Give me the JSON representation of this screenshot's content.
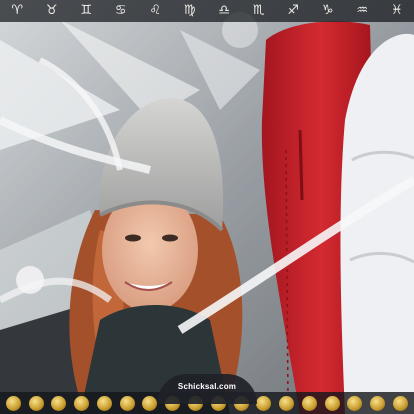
{
  "zodiac_signs": [
    "♈",
    "♉",
    "♊",
    "♋",
    "♌",
    "♍",
    "♎",
    "♏",
    "♐",
    "♑",
    "♒",
    "♓"
  ],
  "brand": {
    "logo_text": "Schicksal.com"
  },
  "colors": {
    "jacket_red": "#c8202a",
    "bar_bg": "#1e2228",
    "icon_gold": "#d9b24a"
  },
  "bottom_icons": [
    "aries-badge-icon",
    "taurus-badge-icon",
    "gemini-badge-icon",
    "cancer-badge-icon",
    "leo-badge-icon",
    "virgo-badge-icon",
    "libra-badge-icon",
    "scorpio-badge-icon",
    "sagittarius-badge-icon",
    "capricorn-badge-icon",
    "aquarius-badge-icon",
    "pisces-badge-icon",
    "moon-badge-icon",
    "star-badge-icon",
    "sun-badge-icon",
    "planet-badge-icon",
    "crystal-badge-icon",
    "rune-badge-icon"
  ]
}
